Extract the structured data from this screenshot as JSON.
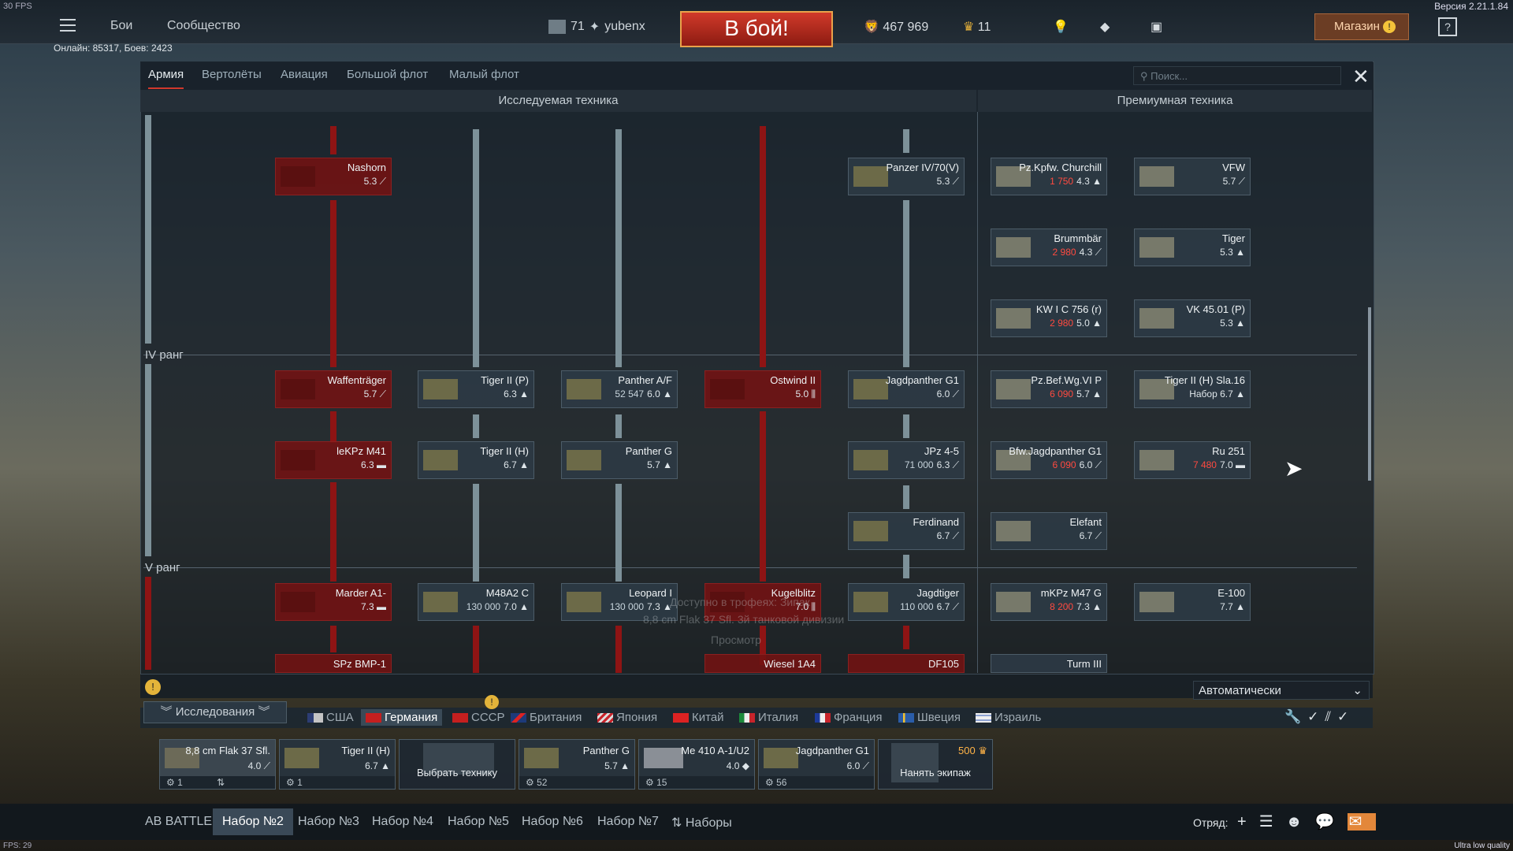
{
  "hud": {
    "fps_top": "30 FPS",
    "version": "Версия 2.21.1.84",
    "fps_bottom": "FPS: 29",
    "quality": "Ultra low quality",
    "online": "Онлайн: 85317, Боев: 2423"
  },
  "topbar": {
    "battles": "Бои",
    "community": "Сообщество",
    "level": "71",
    "username": "yubenx",
    "to_battle": "В бой!",
    "silver": "467 969",
    "gold": "11",
    "shop": "Магазин"
  },
  "tabs": [
    "Армия",
    "Вертолёты",
    "Авиация",
    "Большой флот",
    "Малый флот"
  ],
  "search_placeholder": "Поиск...",
  "sections": {
    "researched": "Исследуемая техника",
    "premium": "Премиумная техника"
  },
  "ranks": {
    "r4": "IV ранг",
    "r5": "V ранг"
  },
  "tree": {
    "nashorn": {
      "name": "Nashorn",
      "br": "5.3"
    },
    "waffen": {
      "name": "Waffenträger",
      "br": "5.7"
    },
    "lekpz": {
      "name": "leKPz M41",
      "br": "6.3"
    },
    "marder": {
      "name": "Marder A1-",
      "br": "7.3"
    },
    "spz": {
      "name": "SPz BMP-1"
    },
    "tiger2p": {
      "name": "Tiger II (P)",
      "br": "6.3"
    },
    "tiger2h": {
      "name": "Tiger II (H)",
      "br": "6.7"
    },
    "m48": {
      "name": "M48A2 C",
      "rp": "130 000",
      "br": "7.0"
    },
    "panther_af": {
      "name": "Panther A/F",
      "rp": "52 547",
      "br": "6.0"
    },
    "panther_g": {
      "name": "Panther G",
      "br": "5.7"
    },
    "leopard": {
      "name": "Leopard I",
      "rp": "130 000",
      "br": "7.3"
    },
    "ostwind": {
      "name": "Ostwind II",
      "br": "5.0"
    },
    "kugel": {
      "name": "Kugelblitz",
      "br": "7.0"
    },
    "wiesel": {
      "name": "Wiesel 1A4"
    },
    "pz4_70": {
      "name": "Panzer IV/70(V)",
      "br": "5.3"
    },
    "jagdp": {
      "name": "Jagdpanther G1",
      "br": "6.0"
    },
    "jpz": {
      "name": "JPz 4-5",
      "rp": "71 000",
      "br": "6.3"
    },
    "ferd": {
      "name": "Ferdinand",
      "br": "6.7"
    },
    "jagdtiger": {
      "name": "Jagdtiger",
      "rp": "110 000",
      "br": "6.7"
    },
    "df105": {
      "name": "DF105"
    }
  },
  "premium": {
    "church": {
      "name": "Pz.Kpfw. Churchill",
      "price": "1 750",
      "br": "4.3"
    },
    "vfw": {
      "name": "VFW",
      "br": "5.7"
    },
    "brumm": {
      "name": "Brummbär",
      "price": "2 980",
      "br": "4.3"
    },
    "tiger": {
      "name": "Tiger",
      "br": "5.3"
    },
    "kw": {
      "name": "KW I C 756 (r)",
      "price": "2 980",
      "br": "5.0"
    },
    "vk": {
      "name": "VK 45.01 (P)",
      "br": "5.3"
    },
    "pzbef": {
      "name": "Pz.Bef.Wg.VI P",
      "price": "6 090",
      "br": "5.7"
    },
    "t2sla": {
      "name": "Tiger II (H) Sla.16",
      "note": "Набор",
      "br": "6.7"
    },
    "befjp": {
      "name": "Bfw.Jagdpanther G1",
      "price": "6 090",
      "br": "6.0"
    },
    "ru251": {
      "name": "Ru 251",
      "price": "7 480",
      "br": "7.0"
    },
    "elef": {
      "name": "Elefant",
      "br": "6.7"
    },
    "mkpz": {
      "name": "mKPz M47 G",
      "price": "8 200",
      "br": "7.3"
    },
    "e100": {
      "name": "E-100",
      "br": "7.7"
    },
    "turm": {
      "name": "Turm III"
    }
  },
  "ghost": {
    "l1": "Доступно в трофеях: Зипак",
    "l2": "8,8 cm Flak 37 Sfl. 3й танковой дивизии",
    "l3": "Просмотр"
  },
  "research_mode": "Автоматически",
  "research_btn": "Исследования",
  "nations": [
    "США",
    "Германия",
    "СССР",
    "Британия",
    "Япония",
    "Китай",
    "Италия",
    "Франция",
    "Швеция",
    "Израиль"
  ],
  "crew": [
    {
      "name": "8,8 cm Flak 37 Sfl.",
      "br": "4.0",
      "pts": "1"
    },
    {
      "name": "Tiger II (H)",
      "br": "6.7",
      "pts": "1"
    },
    {
      "action": "Выбрать технику"
    },
    {
      "name": "Panther G",
      "br": "5.7",
      "pts": "52"
    },
    {
      "name": "Me 410 A-1/U2",
      "br": "4.0",
      "pts": "15"
    },
    {
      "name": "Jagdpanther G1",
      "br": "6.0",
      "pts": "56"
    },
    {
      "action": "Нанять экипаж",
      "price": "500"
    }
  ],
  "presets": [
    "AB BATTLES",
    "Набор №2",
    "Набор №3",
    "Набор №4",
    "Набор №5",
    "Набор №6",
    "Набор №7",
    "Наборы"
  ],
  "squad": "Отряд:"
}
